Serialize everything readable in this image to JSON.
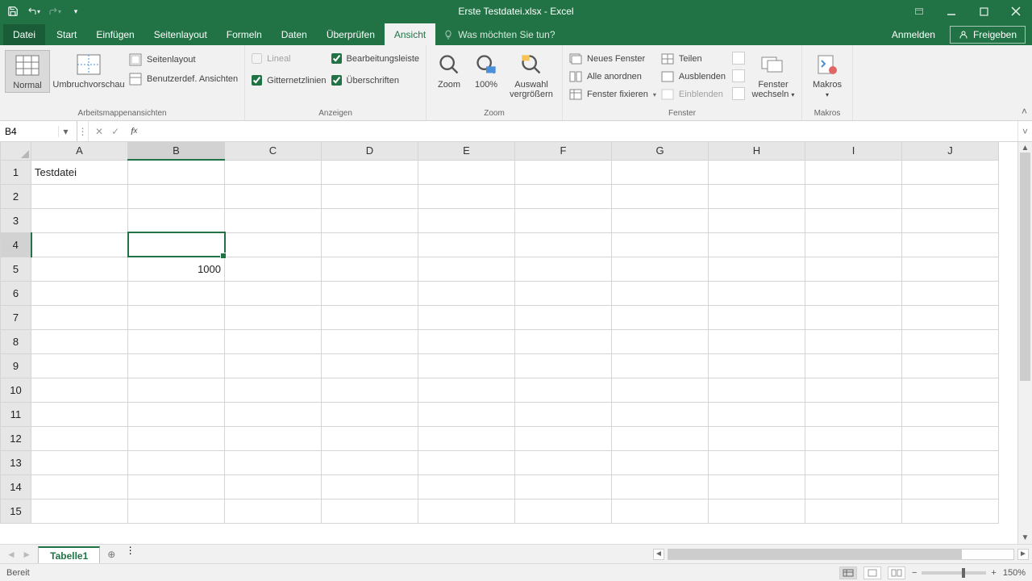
{
  "title": "Erste Testdatei.xlsx - Excel",
  "qat": {
    "save": "save",
    "undo": "undo",
    "redo": "redo"
  },
  "tabs": {
    "file": "Datei",
    "items": [
      "Start",
      "Einfügen",
      "Seitenlayout",
      "Formeln",
      "Daten",
      "Überprüfen",
      "Ansicht"
    ],
    "active": "Ansicht",
    "tellme_placeholder": "Was möchten Sie tun?",
    "signin": "Anmelden",
    "share": "Freigeben"
  },
  "ribbon": {
    "views": {
      "normal": "Normal",
      "pagebreak": "Umbruchvorschau",
      "pagelayout": "Seitenlayout",
      "custom": "Benutzerdef. Ansichten",
      "group": "Arbeitsmappenansichten"
    },
    "show": {
      "ruler": "Lineal",
      "formula_bar": "Bearbeitungsleiste",
      "gridlines": "Gitternetzlinien",
      "headings": "Überschriften",
      "group": "Anzeigen"
    },
    "zoom": {
      "zoom": "Zoom",
      "hundred": "100%",
      "selection1": "Auswahl",
      "selection2": "vergrößern",
      "group": "Zoom"
    },
    "window": {
      "neues_fenster": "Neues Fenster",
      "alle_anordnen": "Alle anordnen",
      "fenster_fixieren": "Fenster fixieren",
      "teilen": "Teilen",
      "ausblenden": "Ausblenden",
      "einblenden": "Einblenden",
      "fenster_wechseln1": "Fenster",
      "fenster_wechseln2": "wechseln",
      "group": "Fenster"
    },
    "macros": {
      "makros": "Makros",
      "group": "Makros"
    }
  },
  "namebox": "B4",
  "formula": "",
  "columns": [
    "A",
    "B",
    "C",
    "D",
    "E",
    "F",
    "G",
    "H",
    "I",
    "J"
  ],
  "rows": [
    "1",
    "2",
    "3",
    "4",
    "5",
    "6",
    "7",
    "8",
    "9",
    "10",
    "11",
    "12",
    "13",
    "14",
    "15"
  ],
  "selected": {
    "col": "B",
    "row": "4"
  },
  "cells": {
    "A1": "Testdatei",
    "B5": "1000"
  },
  "sheet_tab": "Tabelle1",
  "status_ready": "Bereit",
  "zoom_pct": "150%"
}
